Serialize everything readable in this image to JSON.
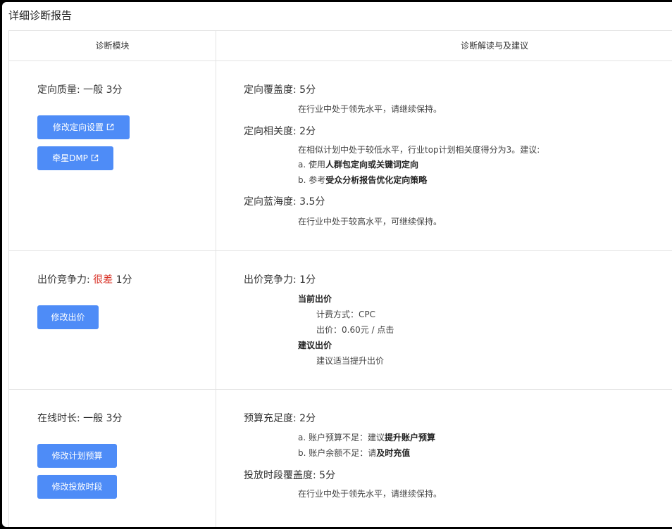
{
  "page": {
    "title": "详细诊断报告"
  },
  "table": {
    "headers": [
      "诊断模块",
      "诊断解读与及建议"
    ]
  },
  "rows": [
    {
      "module": {
        "label": "定向质量: ",
        "level": "一般",
        "score": " 3分"
      },
      "buttons": [
        {
          "label": "修改定向设置",
          "icon": "external-link-icon"
        },
        {
          "label": "牵星DMP",
          "icon": "external-link-icon"
        }
      ],
      "details": {
        "coverage": {
          "title": "定向覆盖度: 5分",
          "desc": "在行业中处于领先水平，请继续保持。"
        },
        "relevance": {
          "title": "定向相关度: 2分",
          "desc": "在相似计划中处于较低水平，行业top计划相关度得分为3。建议:",
          "item_a_prefix": "a. 使用",
          "item_a_strong": "人群包定向或关键词定向",
          "item_b_prefix": "b. 参考",
          "item_b_strong": "受众分析报告优化定向策略"
        },
        "blue_ocean": {
          "title": "定向蓝海度: 3.5分",
          "desc": "在行业中处于较高水平，可继续保持。"
        }
      }
    },
    {
      "module": {
        "label": "出价竞争力: ",
        "level": "很差",
        "score": " 1分"
      },
      "buttons": [
        {
          "label": "修改出价"
        }
      ],
      "details": {
        "title": "出价竞争力: 1分",
        "current_label": "当前出价",
        "billing": "计费方式：CPC",
        "price": "出价：0.60元 / 点击",
        "suggest_label": "建议出价",
        "suggest": "建议适当提升出价"
      }
    },
    {
      "module": {
        "label": "在线时长: ",
        "level": "一般",
        "score": " 3分"
      },
      "buttons": [
        {
          "label": "修改计划预算"
        },
        {
          "label": "修改投放时段"
        }
      ],
      "details": {
        "budget": {
          "title": "预算充足度: 2分",
          "item_a_prefix": "a. 账户预算不足：建议",
          "item_a_strong": "提升账户预算",
          "item_b_prefix": "b. 账户余额不足：请",
          "item_b_strong": "及时充值"
        },
        "schedule": {
          "title": "投放时段覆盖度: 5分",
          "desc": "在行业中处于领先水平，请继续保持。"
        }
      }
    }
  ],
  "colors": {
    "accent": "#4e8cf7",
    "danger": "#d93025"
  }
}
